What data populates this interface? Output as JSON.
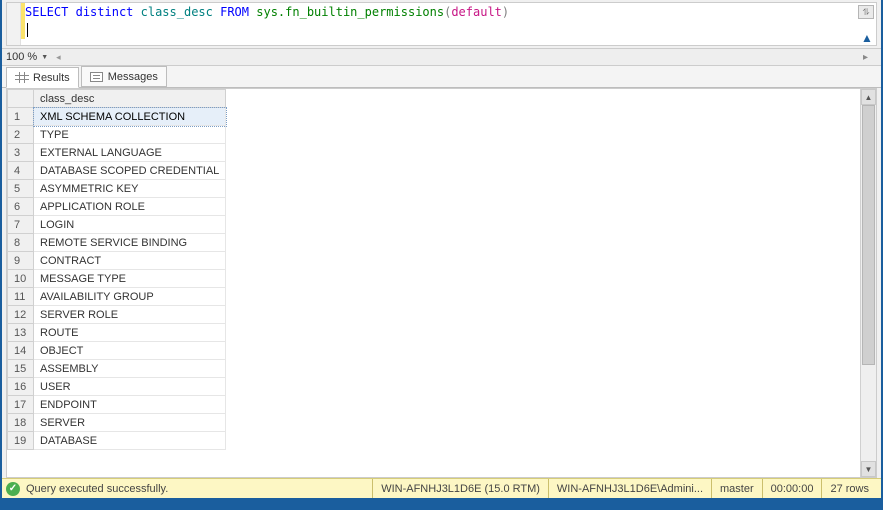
{
  "editor": {
    "sql": {
      "select": "SELECT",
      "distinct": "distinct",
      "col": "class_desc",
      "from": "FROM",
      "schema_fn": "sys.fn_builtin_permissions",
      "paren_open": "(",
      "default_kw": "default",
      "paren_close": ")"
    }
  },
  "zoom": {
    "level": "100 %"
  },
  "tabs": {
    "results": "Results",
    "messages": "Messages"
  },
  "grid": {
    "header": "class_desc",
    "rows": [
      "XML SCHEMA COLLECTION",
      "TYPE",
      "EXTERNAL LANGUAGE",
      "DATABASE SCOPED CREDENTIAL",
      "ASYMMETRIC KEY",
      "APPLICATION ROLE",
      "LOGIN",
      "REMOTE SERVICE BINDING",
      "CONTRACT",
      "MESSAGE TYPE",
      "AVAILABILITY GROUP",
      "SERVER ROLE",
      "ROUTE",
      "OBJECT",
      "ASSEMBLY",
      "USER",
      "ENDPOINT",
      "SERVER",
      "DATABASE"
    ]
  },
  "status": {
    "message": "Query executed successfully.",
    "server": "WIN-AFNHJ3L1D6E (15.0 RTM)",
    "login": "WIN-AFNHJ3L1D6E\\Admini...",
    "database": "master",
    "elapsed": "00:00:00",
    "rows": "27 rows"
  }
}
